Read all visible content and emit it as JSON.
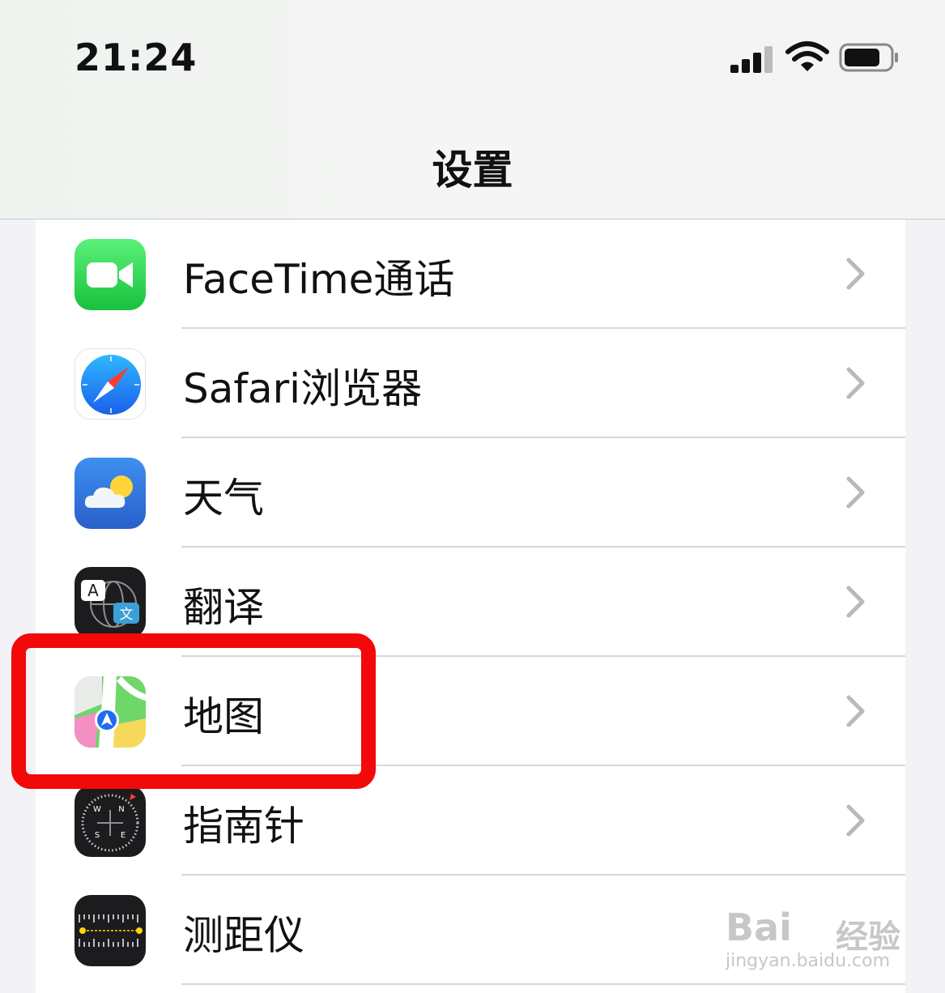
{
  "status_bar": {
    "time": "21:24"
  },
  "header": {
    "title": "设置"
  },
  "rows": [
    {
      "label": "FaceTime通话",
      "icon": "facetime-icon"
    },
    {
      "label": "Safari浏览器",
      "icon": "safari-icon"
    },
    {
      "label": "天气",
      "icon": "weather-icon"
    },
    {
      "label": "翻译",
      "icon": "translate-icon"
    },
    {
      "label": "地图",
      "icon": "maps-icon"
    },
    {
      "label": "指南针",
      "icon": "compass-icon"
    },
    {
      "label": "测距仪",
      "icon": "measure-icon"
    }
  ],
  "icon_text": {
    "translate_a": "A",
    "translate_wen": "文",
    "compass_n": "N",
    "compass_w": "W",
    "compass_s": "S",
    "compass_e": "E"
  },
  "watermark": {
    "brand": "Bai",
    "cn": "经验",
    "url": "jingyan.baidu.com"
  },
  "colors": {
    "highlight": "#f20a0a",
    "facetime_green": "#2fd158",
    "safari_blue": "#1e7cf5",
    "weather_blue": "#2e7be6"
  }
}
